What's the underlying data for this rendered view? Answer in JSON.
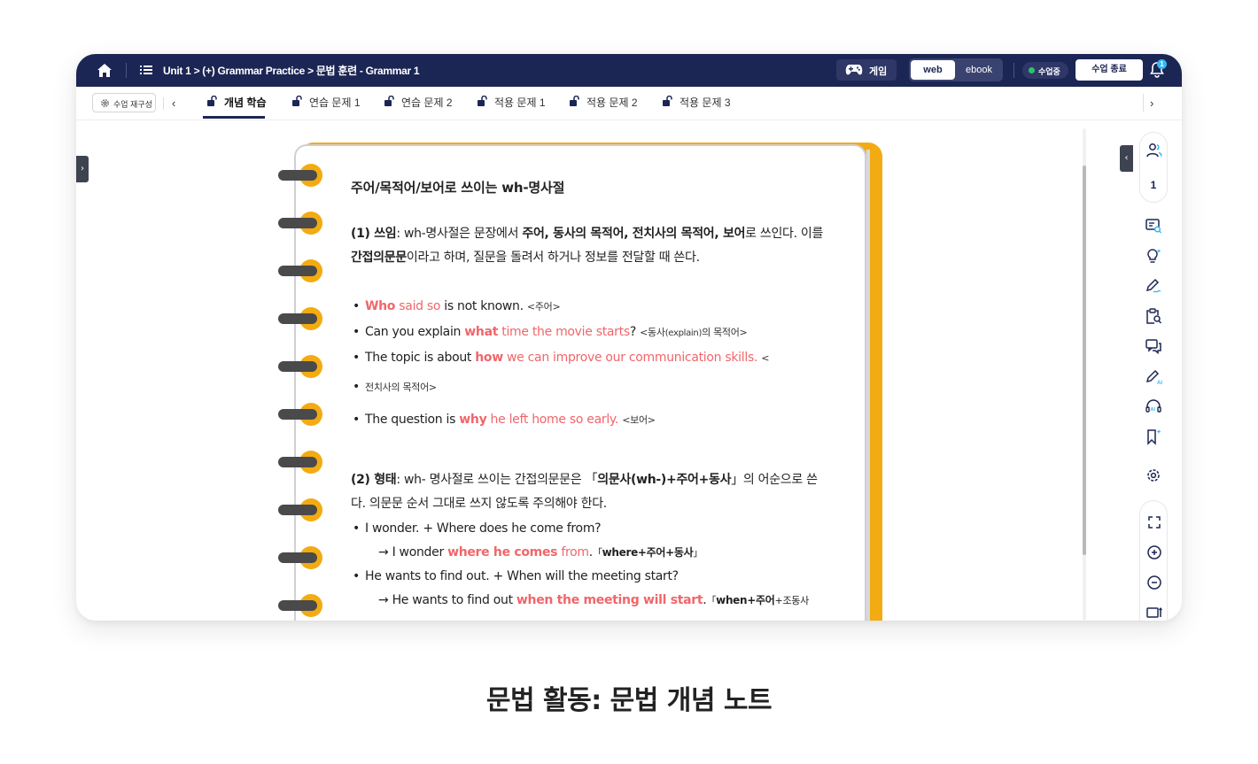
{
  "topbar": {
    "breadcrumb": "Unit 1 > (+) Grammar Practice > 문법 훈련 - Grammar 1",
    "game_label": "게임",
    "mode_web": "web",
    "mode_ebook": "ebook",
    "status_label": "수업중",
    "end_label": "수업 종료",
    "notification_count": "1"
  },
  "tabbar": {
    "reconfigure_label": "수업 재구성",
    "tabs": [
      {
        "label": "개념 학습"
      },
      {
        "label": "연습 문제 1"
      },
      {
        "label": "연습 문제 2"
      },
      {
        "label": "적용 문제 1"
      },
      {
        "label": "적용 문제 2"
      },
      {
        "label": "적용 문제 3"
      }
    ],
    "active_tab": "개념 학습"
  },
  "note": {
    "title": "주어/목적어/보어로 쓰이는 wh-명사절",
    "sec1": {
      "lead": "(1) 쓰임",
      "t1": ": wh-명사절은 문장에서 ",
      "b1": "주어, 동사의 목적어, 전치사의 목적어, 보어",
      "t2": "로 쓰인다. 이를 ",
      "b2": "간접의문문",
      "t3": "이라고 하며, 질문을 돌려서 하거나 정보를 전달할 때 쓴다."
    },
    "ex1": {
      "hw": "Who",
      "rest": " said so",
      "plain": " is not known.",
      "note": "<주어>"
    },
    "ex2": {
      "pre": "Can you explain ",
      "hw": "what",
      "rest": " time the movie starts",
      "q": "?",
      "note": "<동사",
      "note_small": "(explain)",
      "note_end": "의 목적어>"
    },
    "ex3": {
      "pre": "The topic is about ",
      "hw": "how",
      "rest": " we can improve our communication skills.",
      "note_a": "<",
      "note_b": "전치사의 목적어>"
    },
    "ex4": {
      "pre": "The question is ",
      "hw": "why",
      "rest": " he left home so early.",
      "note": "<보어>"
    },
    "sec2": {
      "lead": "(2) 형태",
      "t1": ": wh- 명사절로 쓰이는 간접의문문은 「",
      "b1": "의문사(wh-)+주어+동사",
      "t2": "」의 어순으로 쓴다. 의문문 순서 그대로 쓰지 않도록 주의해야 한다."
    },
    "ex5": {
      "q": "I wonder. + Where does he come from?",
      "a_pre": "→ I wonder ",
      "a_hw": "where he comes",
      "a_rest": " from",
      "a_dot": ".",
      "f_open": "「",
      "f_a": "where",
      "f_b": "+주어+동사",
      "f_close": "」"
    },
    "ex6": {
      "q": "He wants to find out. + When will the meeting start?",
      "a_pre": "→ He wants to find out ",
      "a_hw": "when the meeting will start",
      "a_dot": ".",
      "f_open": "「",
      "f_a": "when",
      "f_b": "+주어",
      "f_c": "+조동사"
    }
  },
  "sidebar": {
    "count": "1"
  },
  "caption": "문법 활동: 문법 개념 노트",
  "colors": {
    "navy": "#1c2654",
    "accent_orange": "#f3ab12",
    "highlight_red": "#f0666a",
    "status_green": "#2ec26b"
  }
}
